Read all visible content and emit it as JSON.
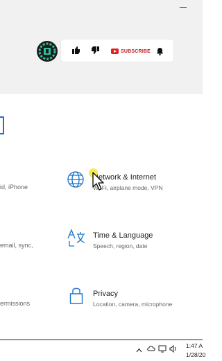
{
  "youtube_bar": {
    "subscribe_label": "SUBSCRIBE"
  },
  "left_partial": {
    "row1": "id, iPhone",
    "row2": "email, sync,",
    "row3": "ermissions"
  },
  "settings": {
    "items": [
      {
        "title": "Network & Internet",
        "subtitle": "Wi-Fi, airplane mode, VPN",
        "icon": "globe-icon"
      },
      {
        "title": "Time & Language",
        "subtitle": "Speech, region, date",
        "icon": "language-icon"
      },
      {
        "title": "Privacy",
        "subtitle": "Location, camera, microphone",
        "icon": "lock-icon"
      }
    ]
  },
  "taskbar": {
    "time": "1:47 A",
    "date": "1/28/20"
  },
  "colors": {
    "accent": "#1a73c9",
    "subscribe_red": "#c4161c"
  }
}
